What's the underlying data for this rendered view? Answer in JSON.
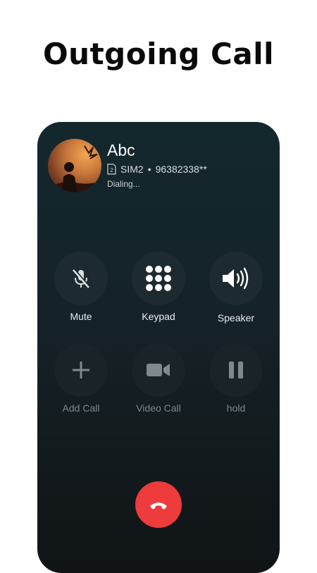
{
  "header": {
    "title": "Outgoing Call"
  },
  "contact": {
    "name": "Abc",
    "sim": "SIM2",
    "separator": "•",
    "number": "96382338**",
    "status": "Dialing...",
    "sim_number": "2"
  },
  "controls": {
    "row1": [
      {
        "label": "Mute",
        "icon": "mic-off-icon"
      },
      {
        "label": "Keypad",
        "icon": "keypad-icon"
      },
      {
        "label": "Speaker",
        "icon": "speaker-icon"
      }
    ],
    "row2": [
      {
        "label": "Add Call",
        "icon": "plus-icon"
      },
      {
        "label": "Video Call",
        "icon": "video-camera-icon"
      },
      {
        "label": "hold",
        "icon": "pause-icon"
      }
    ]
  },
  "end_call": {
    "icon": "phone-hangup-icon",
    "color": "#ee3b3b"
  },
  "colors": {
    "background": "#ffffff",
    "panel": "#13282d",
    "accent_red": "#ee3b3b"
  }
}
